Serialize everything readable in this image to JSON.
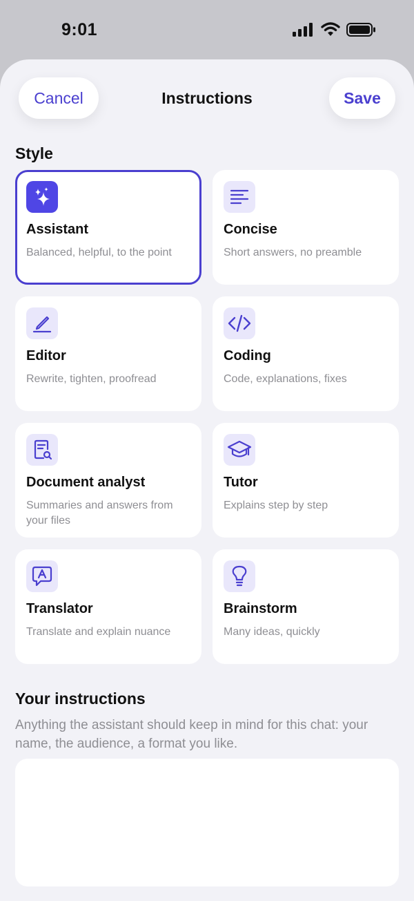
{
  "status_bar": {
    "time": "9:01",
    "icons": [
      "signal-icon",
      "wifi-icon",
      "battery-icon"
    ]
  },
  "header": {
    "cancel_label": "Cancel",
    "title": "Instructions",
    "save_label": "Save"
  },
  "style": {
    "title": "Style",
    "selected": "Assistant",
    "cards": [
      {
        "name": "Assistant",
        "description": "Balanced, helpful, to the point",
        "icon": "sparkles-icon",
        "selected": true
      },
      {
        "name": "Concise",
        "description": "Short answers, no preamble",
        "icon": "lines-icon",
        "selected": false
      },
      {
        "name": "Editor",
        "description": "Rewrite, tighten, proofread",
        "icon": "pen-icon",
        "selected": false
      },
      {
        "name": "Coding",
        "description": "Code, explanations, fixes",
        "icon": "code-icon",
        "selected": false
      },
      {
        "name": "Document analyst",
        "description": "Summaries and answers from your files",
        "icon": "document-search-icon",
        "selected": false
      },
      {
        "name": "Tutor",
        "description": "Explains step by step",
        "icon": "graduation-cap-icon",
        "selected": false
      },
      {
        "name": "Translator",
        "description": "Translate and explain nuance",
        "icon": "translate-bubble-icon",
        "selected": false
      },
      {
        "name": "Brainstorm",
        "description": "Many ideas, quickly",
        "icon": "lightbulb-icon",
        "selected": false
      }
    ]
  },
  "instructions": {
    "title": "Your instructions",
    "help": "Anything the assistant should keep in mind for this chat: your name, the audience, a format you like.",
    "value": "",
    "placeholder": ""
  },
  "colors": {
    "accent": "#4a3fcf",
    "sheet_background": "#f2f2f7",
    "card_background": "#ffffff",
    "icon_tile": "#e9e7fb",
    "secondary_text": "#8e8e93"
  }
}
